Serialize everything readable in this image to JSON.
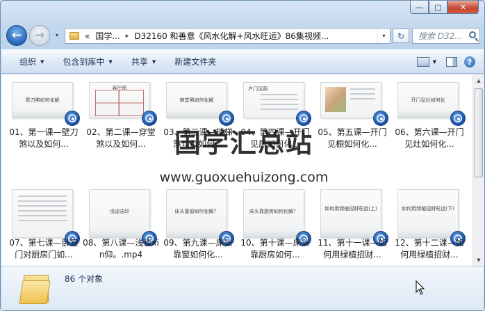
{
  "window": {
    "caption_min": "—",
    "caption_max": "□",
    "caption_close": "✕"
  },
  "nav": {
    "back_glyph": "←",
    "forward_glyph": "→",
    "history_glyph": "▾"
  },
  "address": {
    "chevron": "«",
    "crumbs": [
      "国学...",
      "D32160 和善意《风水化解+风水旺运》86集视频..."
    ],
    "separator": "▸",
    "dropdown_glyph": "▾",
    "refresh_glyph": "↻"
  },
  "search": {
    "placeholder": "搜索 D32..."
  },
  "toolbar": {
    "organize": "组织",
    "include_in_library": "包含到库中",
    "share": "共享",
    "new_folder": "新建文件夹",
    "caret": "▼",
    "help_glyph": "?"
  },
  "thumbs": {
    "t1": "章刀煞如何化解",
    "t2": "客厅图",
    "t4": "户门见厕",
    "t6": "开门见灶如何化",
    "t8": "浅谈洁印",
    "t9": "床头靠窗如何化解？",
    "t10": "床头靠厨房如何化解？",
    "t11": "如何用绿植招财旺运(上)",
    "t12": "如何用绿植招财旺运(下)",
    "t3": "穿堂煞如何化解"
  },
  "files": [
    {
      "label": "01、第一课—壁刀煞以及如何..."
    },
    {
      "label": "02、第二课—穿堂煞以及如何..."
    },
    {
      "label": "03、第三课—楼梯煞以及如何..."
    },
    {
      "label": "04、第四课—开门见厕如何化..."
    },
    {
      "label": "05、第五课—开门见橱如何化..."
    },
    {
      "label": "06、第六课—开门见灶如何化..."
    },
    {
      "label": "07、第七课—卧室门对厨房门如..."
    },
    {
      "label": "08、第八课—浅谈xin仰。.mp4"
    },
    {
      "label": "09、第九课—床头靠窗如何化..."
    },
    {
      "label": "10、第十课—床头靠厨房如何..."
    },
    {
      "label": "11、第十一课—如何用绿植招财..."
    },
    {
      "label": "12、第十二课—如何用绿植招财..."
    }
  ],
  "watermark": {
    "title": "国学汇总站",
    "url": "www.guoxuehuizong.com"
  },
  "details": {
    "count": "86 个对象"
  },
  "scrollbar": {
    "up": "▲",
    "down": "▼"
  }
}
